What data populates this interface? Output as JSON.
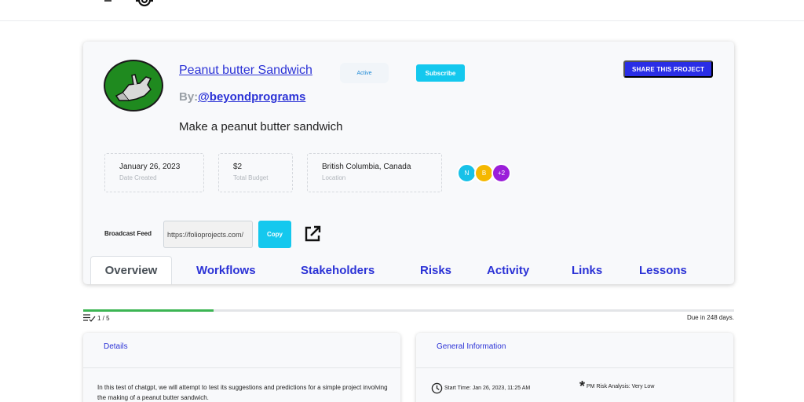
{
  "project": {
    "title": "Peanut butter Sandwich",
    "status": "Active",
    "subscribe_label": "Subscribe",
    "share_label": "SHARE THIS PROJECT",
    "by_label": "By:",
    "owner_handle": "@beyondprograms",
    "description": "Make a peanut butter sandwich"
  },
  "info": [
    {
      "value": "January 26, 2023",
      "label": "Date Created"
    },
    {
      "value": "$2",
      "label": "Total Budget"
    },
    {
      "value": "British Columbia, Canada",
      "label": "Location"
    }
  ],
  "members": [
    {
      "initial": "N",
      "color": "#17c1e8"
    },
    {
      "initial": "B",
      "color": "#f5b800"
    },
    {
      "initial": "+2",
      "color": "#9b1fd9"
    }
  ],
  "feed": {
    "label": "Broadcast Feed",
    "url": "https://folioprojects.com/",
    "copy_label": "Copy"
  },
  "tabs": [
    "Overview",
    "Workflows",
    "Stakeholders",
    "Risks",
    "Activity",
    "Links",
    "Lessons"
  ],
  "progress": {
    "tasks_text": "1 / 5",
    "fraction": 0.2,
    "due_text": "Due in 248 days."
  },
  "details": {
    "title": "Details",
    "text": "In this test of chatgpt, we will attempt to test its suggestions and predictions for a simple project involving the making of a peanut butter sandwich."
  },
  "general_info": {
    "title": "General Information",
    "start_time": "Start Time: Jan 26, 2023, 11:25 AM",
    "risk": "PM Risk Analysis: Very Low"
  },
  "colors": {
    "accent": "#2b32d6",
    "cyan": "#14c8ee",
    "share": "#2a2ee6",
    "progress": "#3cb553"
  }
}
